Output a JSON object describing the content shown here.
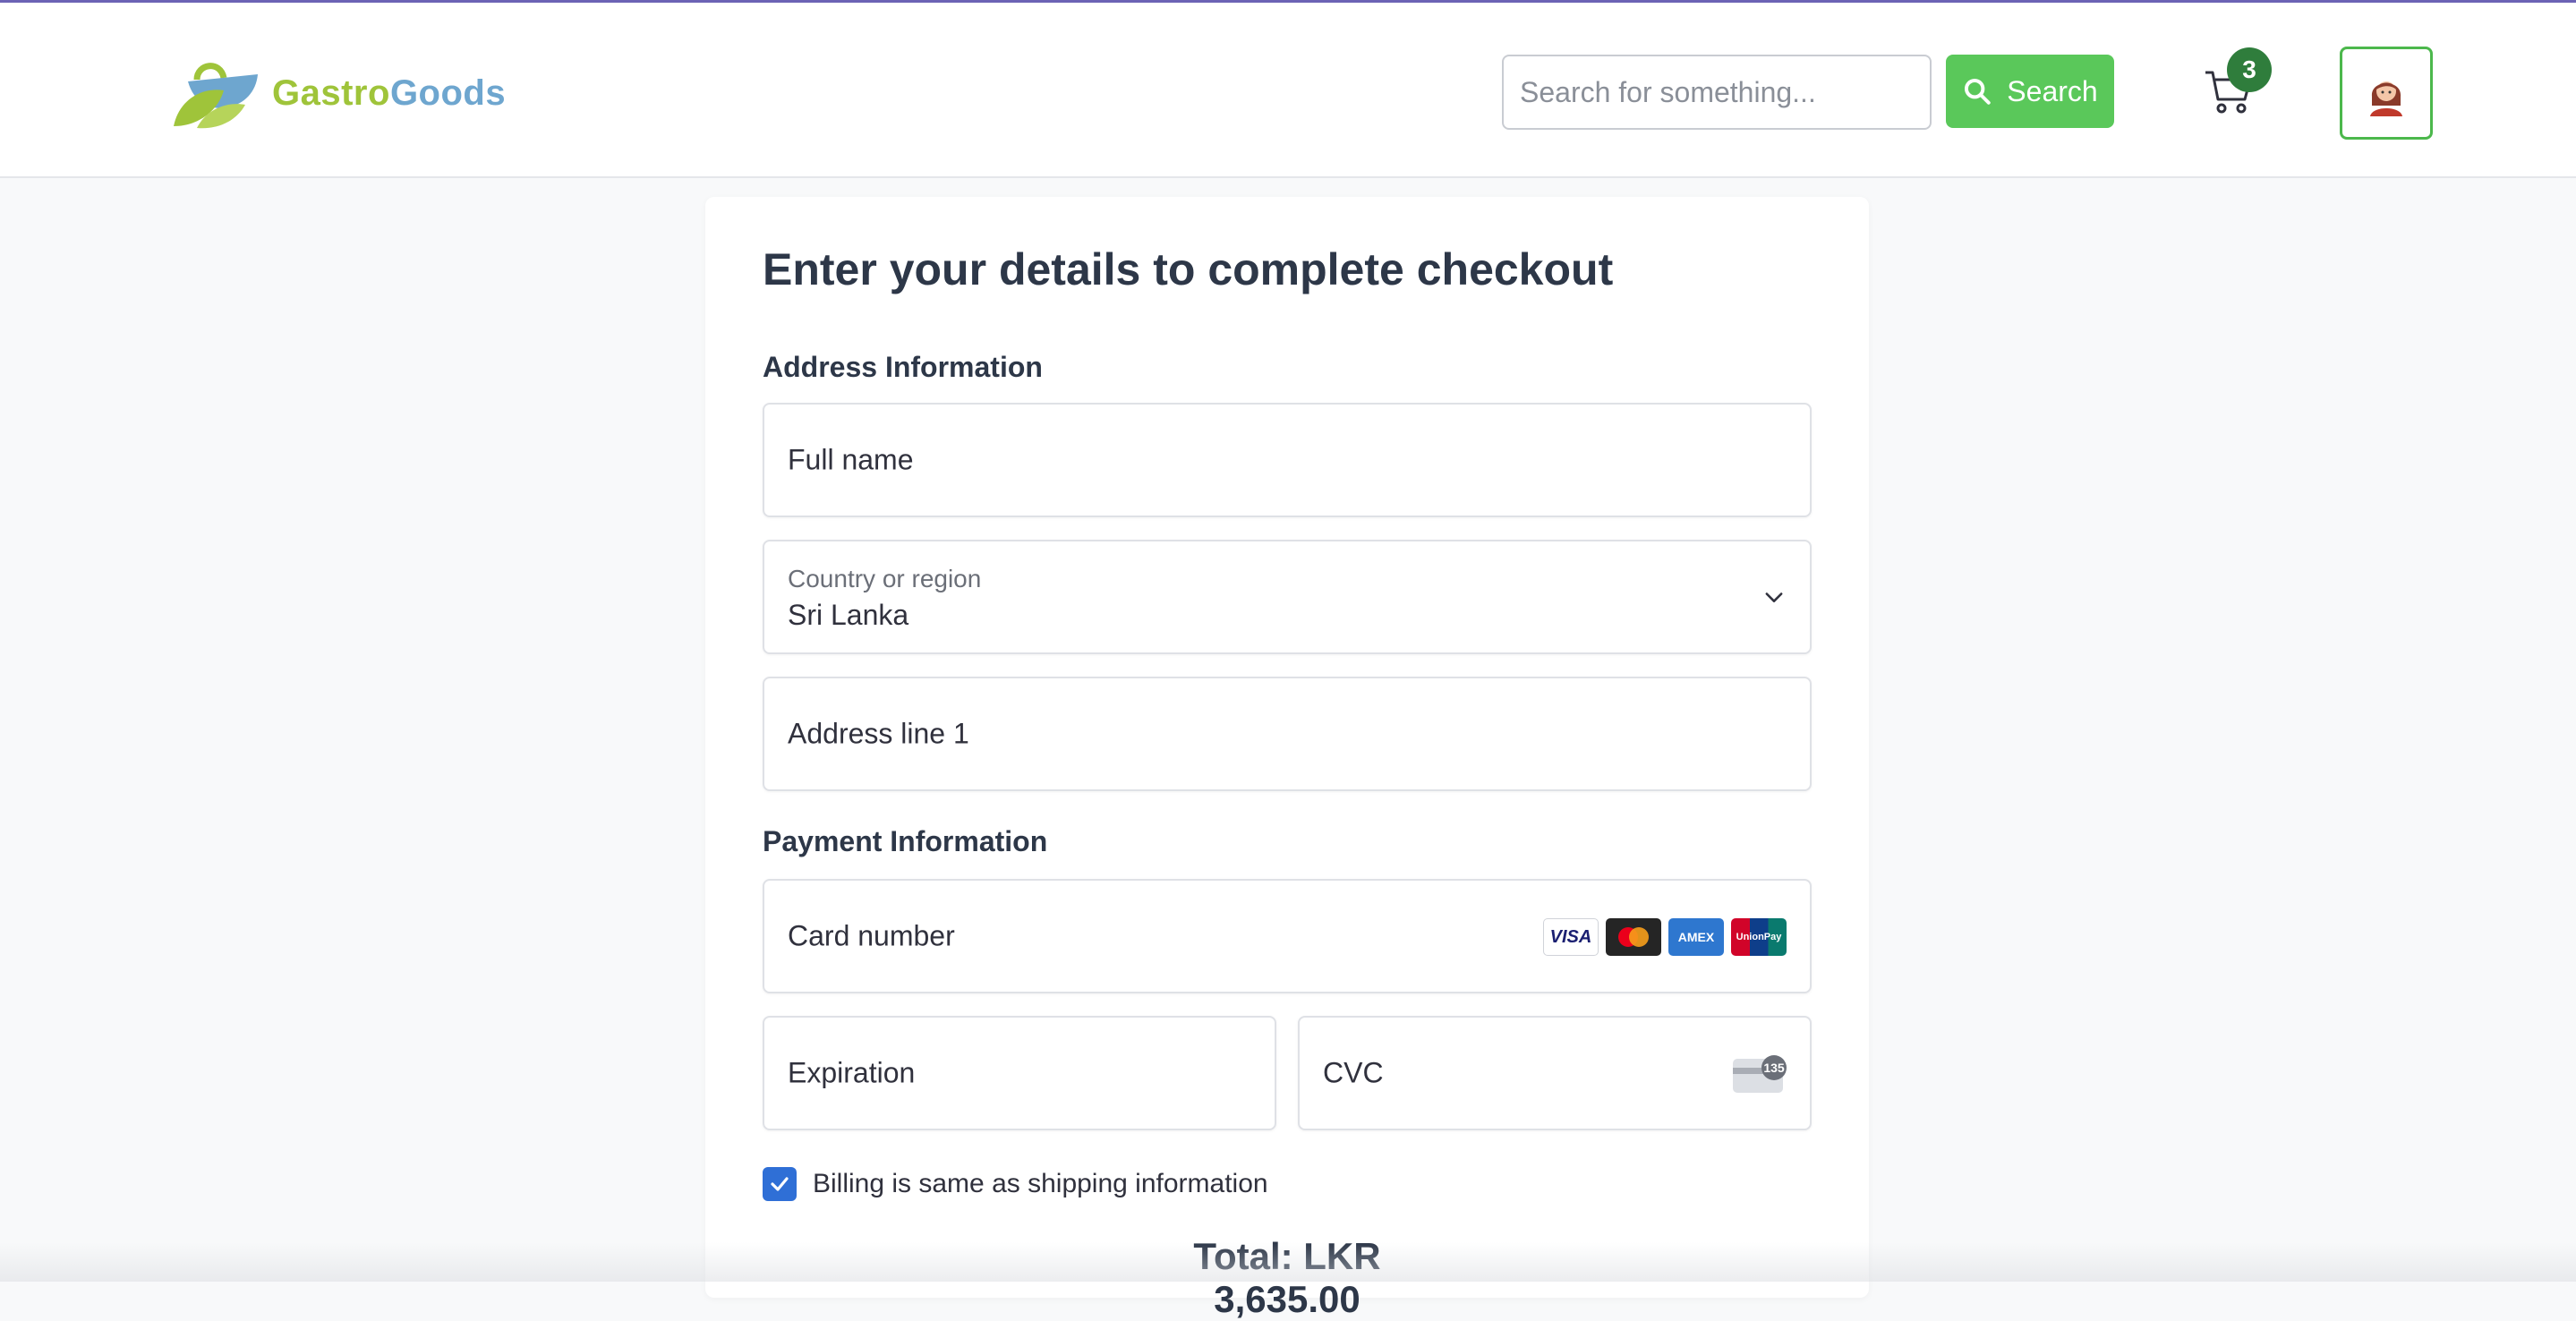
{
  "header": {
    "brand_part1": "Gastro",
    "brand_part2": "Goods",
    "search_placeholder": "Search for something...",
    "search_button_label": "Search",
    "cart_count": "3",
    "logo_icon": "basket-leaf-logo",
    "search_icon": "search-icon",
    "cart_icon": "cart-icon",
    "avatar_icon": "user-avatar-icon"
  },
  "checkout": {
    "title": "Enter your details to complete checkout",
    "address_section": "Address Information",
    "full_name_placeholder": "Full name",
    "country_label": "Country or region",
    "country_value": "Sri Lanka",
    "address_line1_placeholder": "Address line 1",
    "payment_section": "Payment Information",
    "card_number_placeholder": "Card number",
    "card_brands": [
      "VISA",
      "Mastercard",
      "AMEX",
      "UnionPay"
    ],
    "expiration_placeholder": "Expiration",
    "cvc_placeholder": "CVC",
    "cvc_badge": "135",
    "billing_same_label": "Billing is same as shipping information",
    "billing_same_checked": true,
    "total": "Total: LKR 3,635.00"
  },
  "colors": {
    "accent_green": "#5ac85a",
    "badge_green": "#2f7d3c",
    "checkbox_blue": "#2f6fd6",
    "brand_green": "#9fc43a",
    "brand_blue": "#6ea6cf",
    "top_line": "#6c63b5"
  }
}
